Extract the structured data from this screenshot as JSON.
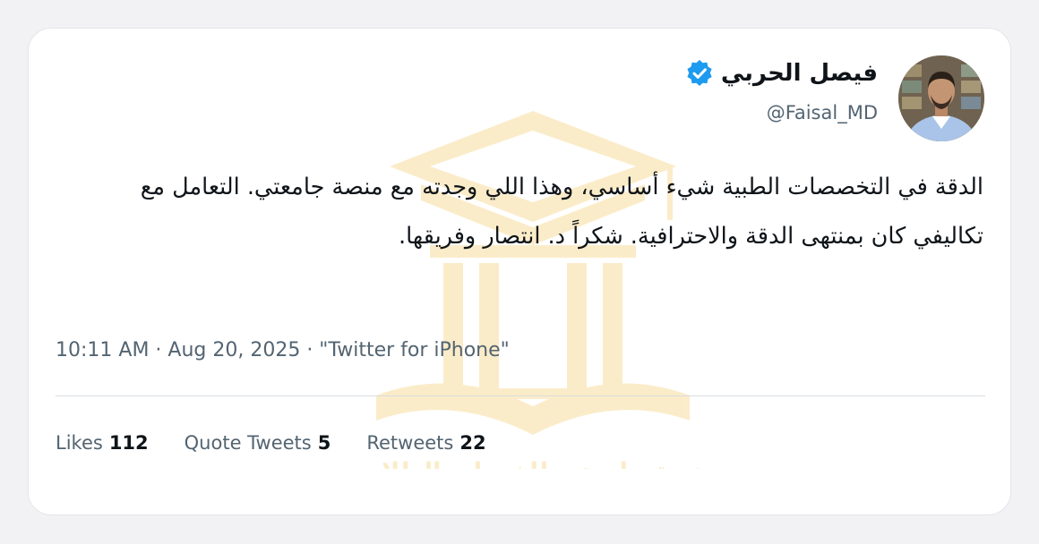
{
  "tweet": {
    "author": {
      "display_name": "فيصل الحربي",
      "handle": "@Faisal_MD",
      "verified": true,
      "avatar_icon": "avatar-photo-icon"
    },
    "text": "الدقة في التخصصات الطبية شيء أساسي، وهذا اللي وجدته مع منصة جامعتي. التعامل مع تكاليفي كان بمنتهى الدقة والاحترافية. شكراً د. انتصار وفريقها.",
    "meta": "10:11 AM · Aug 20, 2025 · \"Twitter for iPhone\"",
    "stats": {
      "likes_label": "Likes",
      "likes_count": "112",
      "quotes_label": "Quote Tweets",
      "quotes_count": "5",
      "retweets_label": "Retweets",
      "retweets_count": "22"
    }
  },
  "watermark": {
    "text": "منصة جامعتي للخدمات الطلابية",
    "icon": "graduation-cap-book-logo",
    "color": "#f2c14e"
  },
  "colors": {
    "verified_blue": "#1d9bf0",
    "text_primary": "#0f1419",
    "text_secondary": "#536471"
  }
}
